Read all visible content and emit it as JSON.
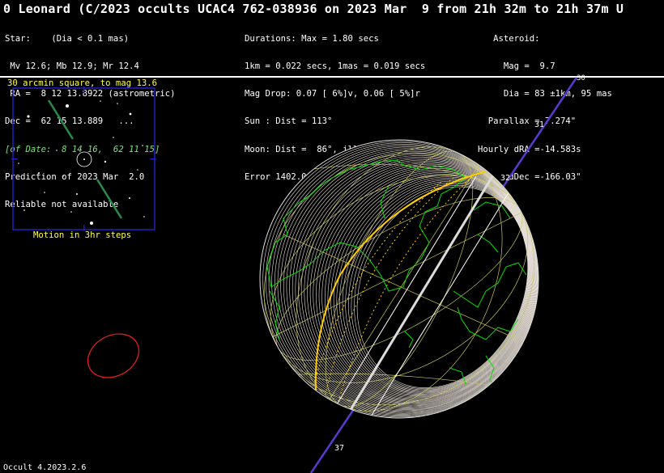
{
  "header": {
    "title": "0 Leonard (C/2023 occults UCAC4 762-038936 on 2023 Mar  9 from 21h 32m to 21h 37m U"
  },
  "star_block": [
    "Star:    (Dia < 0.1 mas)",
    " Mv 12.6; Mb 12.9; Mr 12.4",
    " RA =  8 12 13.8922 (astrometric)",
    "Dec =  62 15 13.889   ..."
  ],
  "star_of_date": "[of Date:  8 14 16,  62 11 15]",
  "prediction": [
    "Prediction of 2023 Mar  2.0",
    "Reliable not available"
  ],
  "durations_block": [
    "Durations: Max = 1.80 secs",
    "1km = 0.022 secs, 1mas = 0.019 secs",
    "Mag Drop: 0.07 [ 6%]v, 0.06 [ 5%]r",
    "Sun : Dist = 113°",
    "Moon: Dist =  86°, illum = 95%",
    "Error 1402.0 x 979.0 mas in PA 62°"
  ],
  "asteroid_block": [
    "   Asteroid:",
    "     Mag =  9.7",
    "     Dia = 83 ±1km, 95 mas",
    "  Parallax = 7.274\"",
    "Hourly dRA =-14.583s",
    "      dDec =-166.03\""
  ],
  "finder": {
    "caption": "30 arcmin square, to mag 13.6",
    "motion": "Motion in 3hr steps"
  },
  "path_labels": [
    "31",
    "32",
    "37",
    "30"
  ],
  "footer": "Occult 4.2023.2.6",
  "colors": {
    "path_line": "#5a3ad0",
    "coast": "#00e000",
    "grid": "#c8c860",
    "path_edge": "#ffcc00",
    "ellipse": "#e02020",
    "finder_frame": "#2020c0"
  }
}
